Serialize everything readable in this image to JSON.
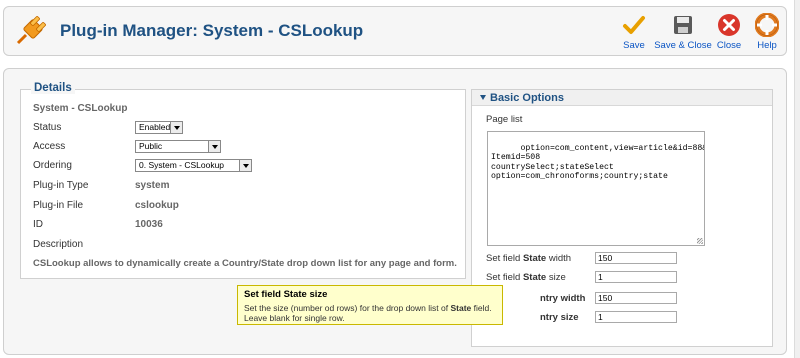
{
  "header": {
    "title": "Plug-in Manager: System - CSLookup"
  },
  "toolbar": {
    "save_label": "Save",
    "save_close_label": "Save & Close",
    "close_label": "Close",
    "help_label": "Help"
  },
  "details": {
    "legend": "Details",
    "subtitle": "System - CSLookup",
    "status_label": "Status",
    "status_value": "Enabled",
    "access_label": "Access",
    "access_value": "Public",
    "ordering_label": "Ordering",
    "ordering_value": "0. System - CSLookup",
    "type_label": "Plug-in Type",
    "type_value": "system",
    "file_label": "Plug-in File",
    "file_value": "cslookup",
    "id_label": "ID",
    "id_value": "10036",
    "description_label": "Description",
    "description_text": "CSLookup allows to dynamically create a Country/State drop down list for any page and form."
  },
  "options": {
    "header": "Basic Options",
    "page_list_label": "Page list",
    "page_list_value": "option=com_content,view=article&id=88&\nItemid=508\ncountrySelect;stateSelect\noption=com_chronoforms;country;state",
    "state_width_label_pre": "Set field ",
    "state_width_label_bold": "State",
    "state_width_label_post": " width",
    "state_width_value": "150",
    "state_size_label_pre": "Set field ",
    "state_size_label_bold": "State",
    "state_size_label_post": " size",
    "state_size_value": "1",
    "country_width_label_partial": "ntry width",
    "country_width_value": "150",
    "country_size_label_partial": "ntry size",
    "country_size_value": "1"
  },
  "tooltip": {
    "title_pre": "Set field ",
    "title_bold": "State",
    "title_post": " size",
    "body_pre": "Set the size (number od rows) for the drop down list of ",
    "body_bold": "State",
    "body_post": " field. Leave blank for single row."
  },
  "colors": {
    "accent": "#1f5283",
    "link": "#0b55c4",
    "tooltip_bg": "#ffffcc"
  }
}
